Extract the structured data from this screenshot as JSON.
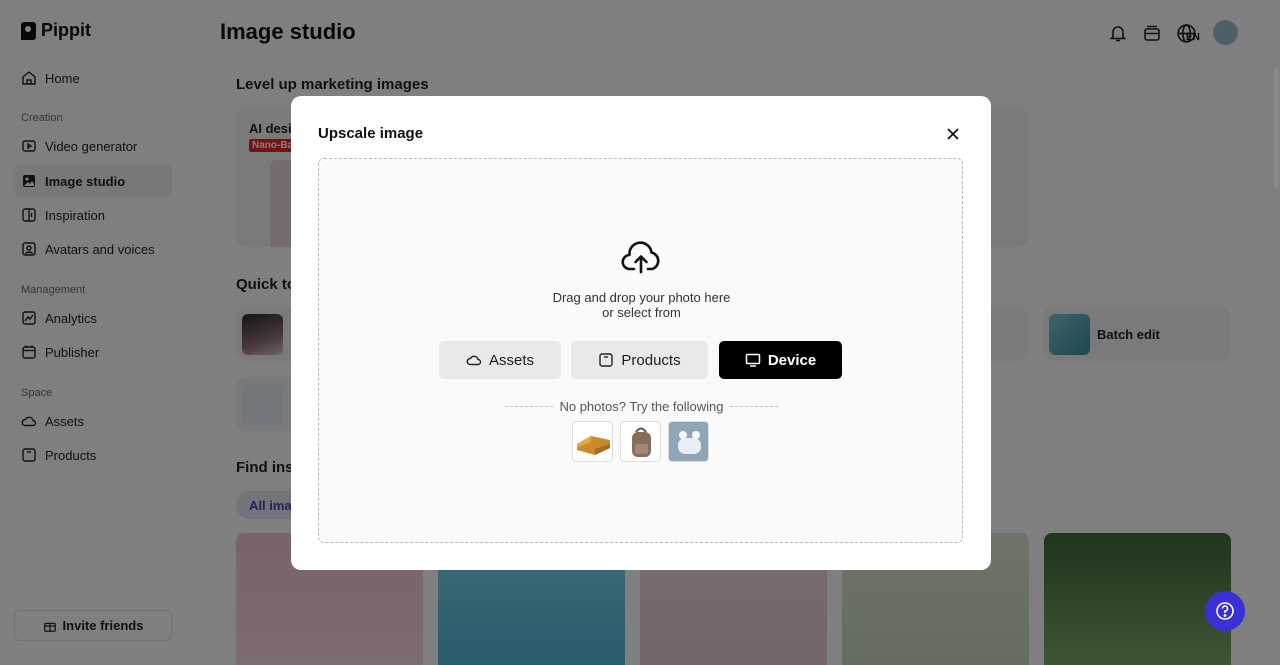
{
  "app": {
    "brand": "Pippit",
    "page_title": "Image studio"
  },
  "sidebar": {
    "home": "Home",
    "sections": {
      "creation": "Creation",
      "management": "Management",
      "space": "Space"
    },
    "items": {
      "video_generator": "Video generator",
      "image_studio": "Image studio",
      "inspiration": "Inspiration",
      "avatars": "Avatars and voices",
      "analytics": "Analytics",
      "publisher": "Publisher",
      "assets": "Assets",
      "products": "Products"
    },
    "invite": "Invite friends"
  },
  "header": {
    "lang_badge": "EN"
  },
  "main": {
    "level_up_title": "Level up marketing images",
    "hero_text": "AI desig",
    "hero_badge": "Nano-Ba",
    "quick_tools_title": "Quick to",
    "batch_edit": "Batch edit",
    "find_inspiration_title": "Find insp",
    "filter_all": "All imag"
  },
  "modal": {
    "title": "Upscale image",
    "drop_line1": "Drag and drop your photo here",
    "drop_line2": "or select from",
    "buttons": {
      "assets": "Assets",
      "products": "Products",
      "device": "Device"
    },
    "no_photos": "No photos? Try the following"
  },
  "icons": [
    "home-icon",
    "video-icon",
    "image-icon",
    "inspiration-icon",
    "avatar-icon",
    "analytics-icon",
    "calendar-icon",
    "cloud-icon",
    "box-icon",
    "bell-icon",
    "stack-icon",
    "globe-icon",
    "close-icon",
    "upload-cloud-icon",
    "monitor-icon",
    "help-icon"
  ],
  "colors": {
    "accent": "#3b2fd6",
    "badge_red": "#e8262b",
    "device_button": "#000000"
  }
}
